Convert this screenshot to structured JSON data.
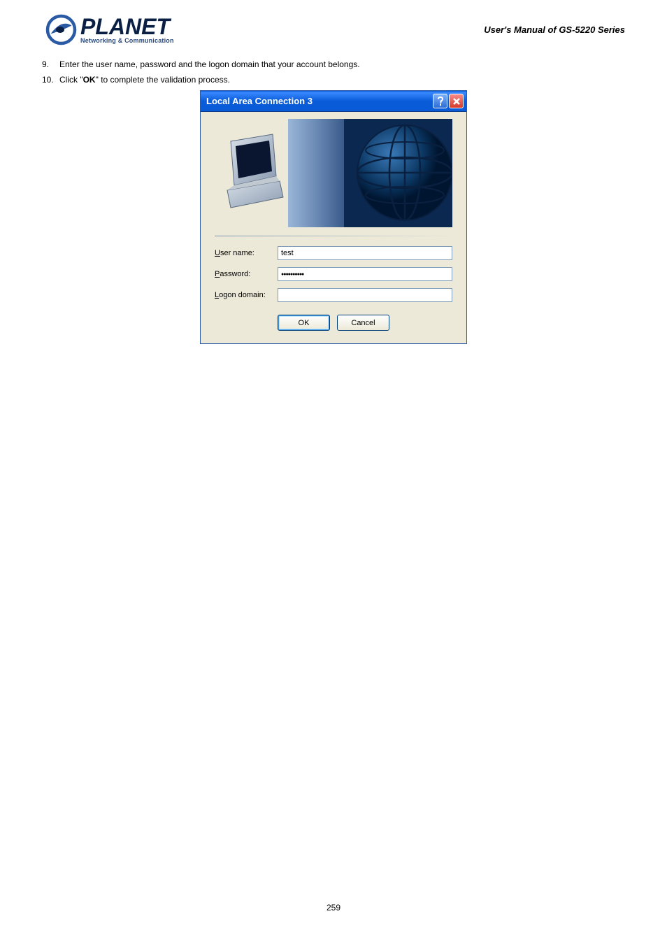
{
  "header": {
    "brand": "PLANET",
    "tagline": "Networking & Communication",
    "manual_title": "User's Manual of GS-5220 Series"
  },
  "steps": [
    {
      "num": "9.",
      "text": "Enter the user name, password and the logon domain that your account belongs."
    },
    {
      "num": "10.",
      "text_pre": "Click \"",
      "text_mid": "OK",
      "text_post": "\" to complete the validation process."
    }
  ],
  "dialog": {
    "title": "Local Area Connection 3",
    "labels": {
      "username_u": "U",
      "username_rest": "ser name:",
      "password_u": "P",
      "password_rest": "assword:",
      "logon_u": "L",
      "logon_rest": "ogon domain:"
    },
    "values": {
      "username": "test",
      "password": "●●●●●●●●●●",
      "logon": ""
    },
    "buttons": {
      "ok": "OK",
      "cancel": "Cancel"
    }
  },
  "page_number": "259"
}
